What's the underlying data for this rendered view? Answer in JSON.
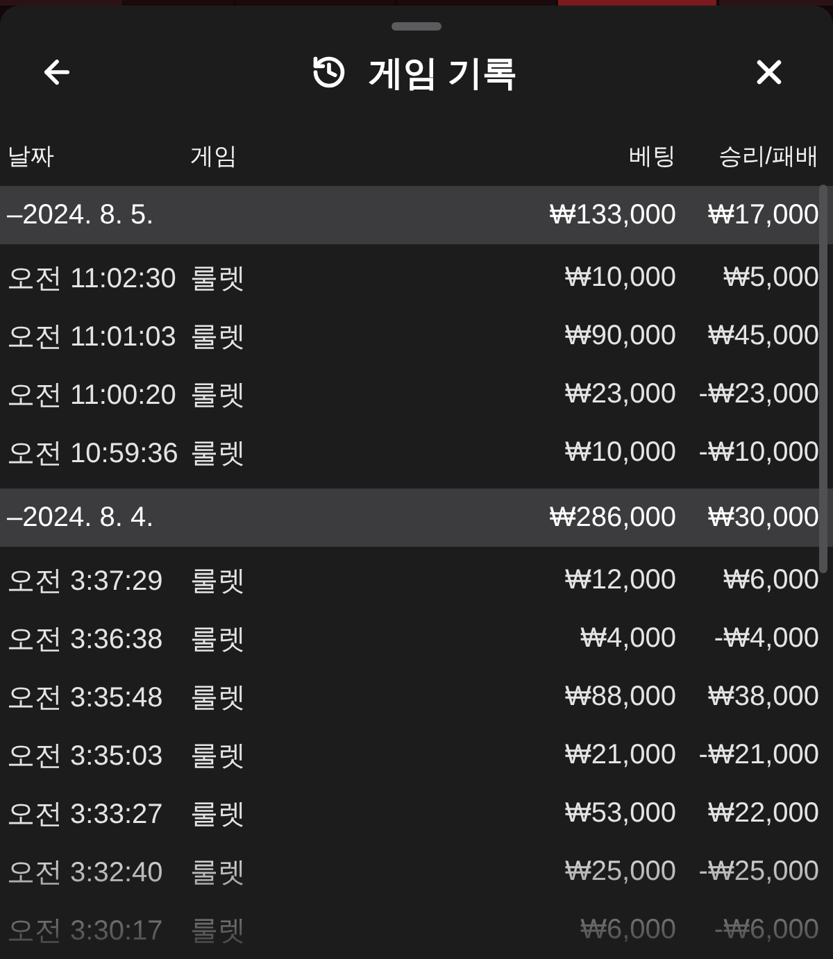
{
  "sheet": {
    "title": "게임 기록"
  },
  "columns": [
    "날짜",
    "게임",
    "베팅",
    "승리/패배"
  ],
  "groups": [
    {
      "date": "–2024. 8. 5.",
      "bet": "₩133,000",
      "result": "₩17,000",
      "rows": [
        {
          "time": "오전 11:02:30",
          "game": "룰렛",
          "bet": "₩10,000",
          "result": "₩5,000"
        },
        {
          "time": "오전 11:01:03",
          "game": "룰렛",
          "bet": "₩90,000",
          "result": "₩45,000"
        },
        {
          "time": "오전 11:00:20",
          "game": "룰렛",
          "bet": "₩23,000",
          "result": "-₩23,000"
        },
        {
          "time": "오전 10:59:36",
          "game": "룰렛",
          "bet": "₩10,000",
          "result": "-₩10,000"
        }
      ]
    },
    {
      "date": "–2024. 8. 4.",
      "bet": "₩286,000",
      "result": "₩30,000",
      "rows": [
        {
          "time": "오전 3:37:29",
          "game": "룰렛",
          "bet": "₩12,000",
          "result": "₩6,000"
        },
        {
          "time": "오전 3:36:38",
          "game": "룰렛",
          "bet": "₩4,000",
          "result": "-₩4,000"
        },
        {
          "time": "오전 3:35:48",
          "game": "룰렛",
          "bet": "₩88,000",
          "result": "₩38,000"
        },
        {
          "time": "오전 3:35:03",
          "game": "룰렛",
          "bet": "₩21,000",
          "result": "-₩21,000"
        },
        {
          "time": "오전 3:33:27",
          "game": "룰렛",
          "bet": "₩53,000",
          "result": "₩22,000"
        },
        {
          "time": "오전 3:32:40",
          "game": "룰렛",
          "bet": "₩25,000",
          "result": "-₩25,000"
        },
        {
          "time": "오전 3:30:17",
          "game": "룰렛",
          "bet": "₩6,000",
          "result": "-₩6,000"
        }
      ]
    }
  ]
}
